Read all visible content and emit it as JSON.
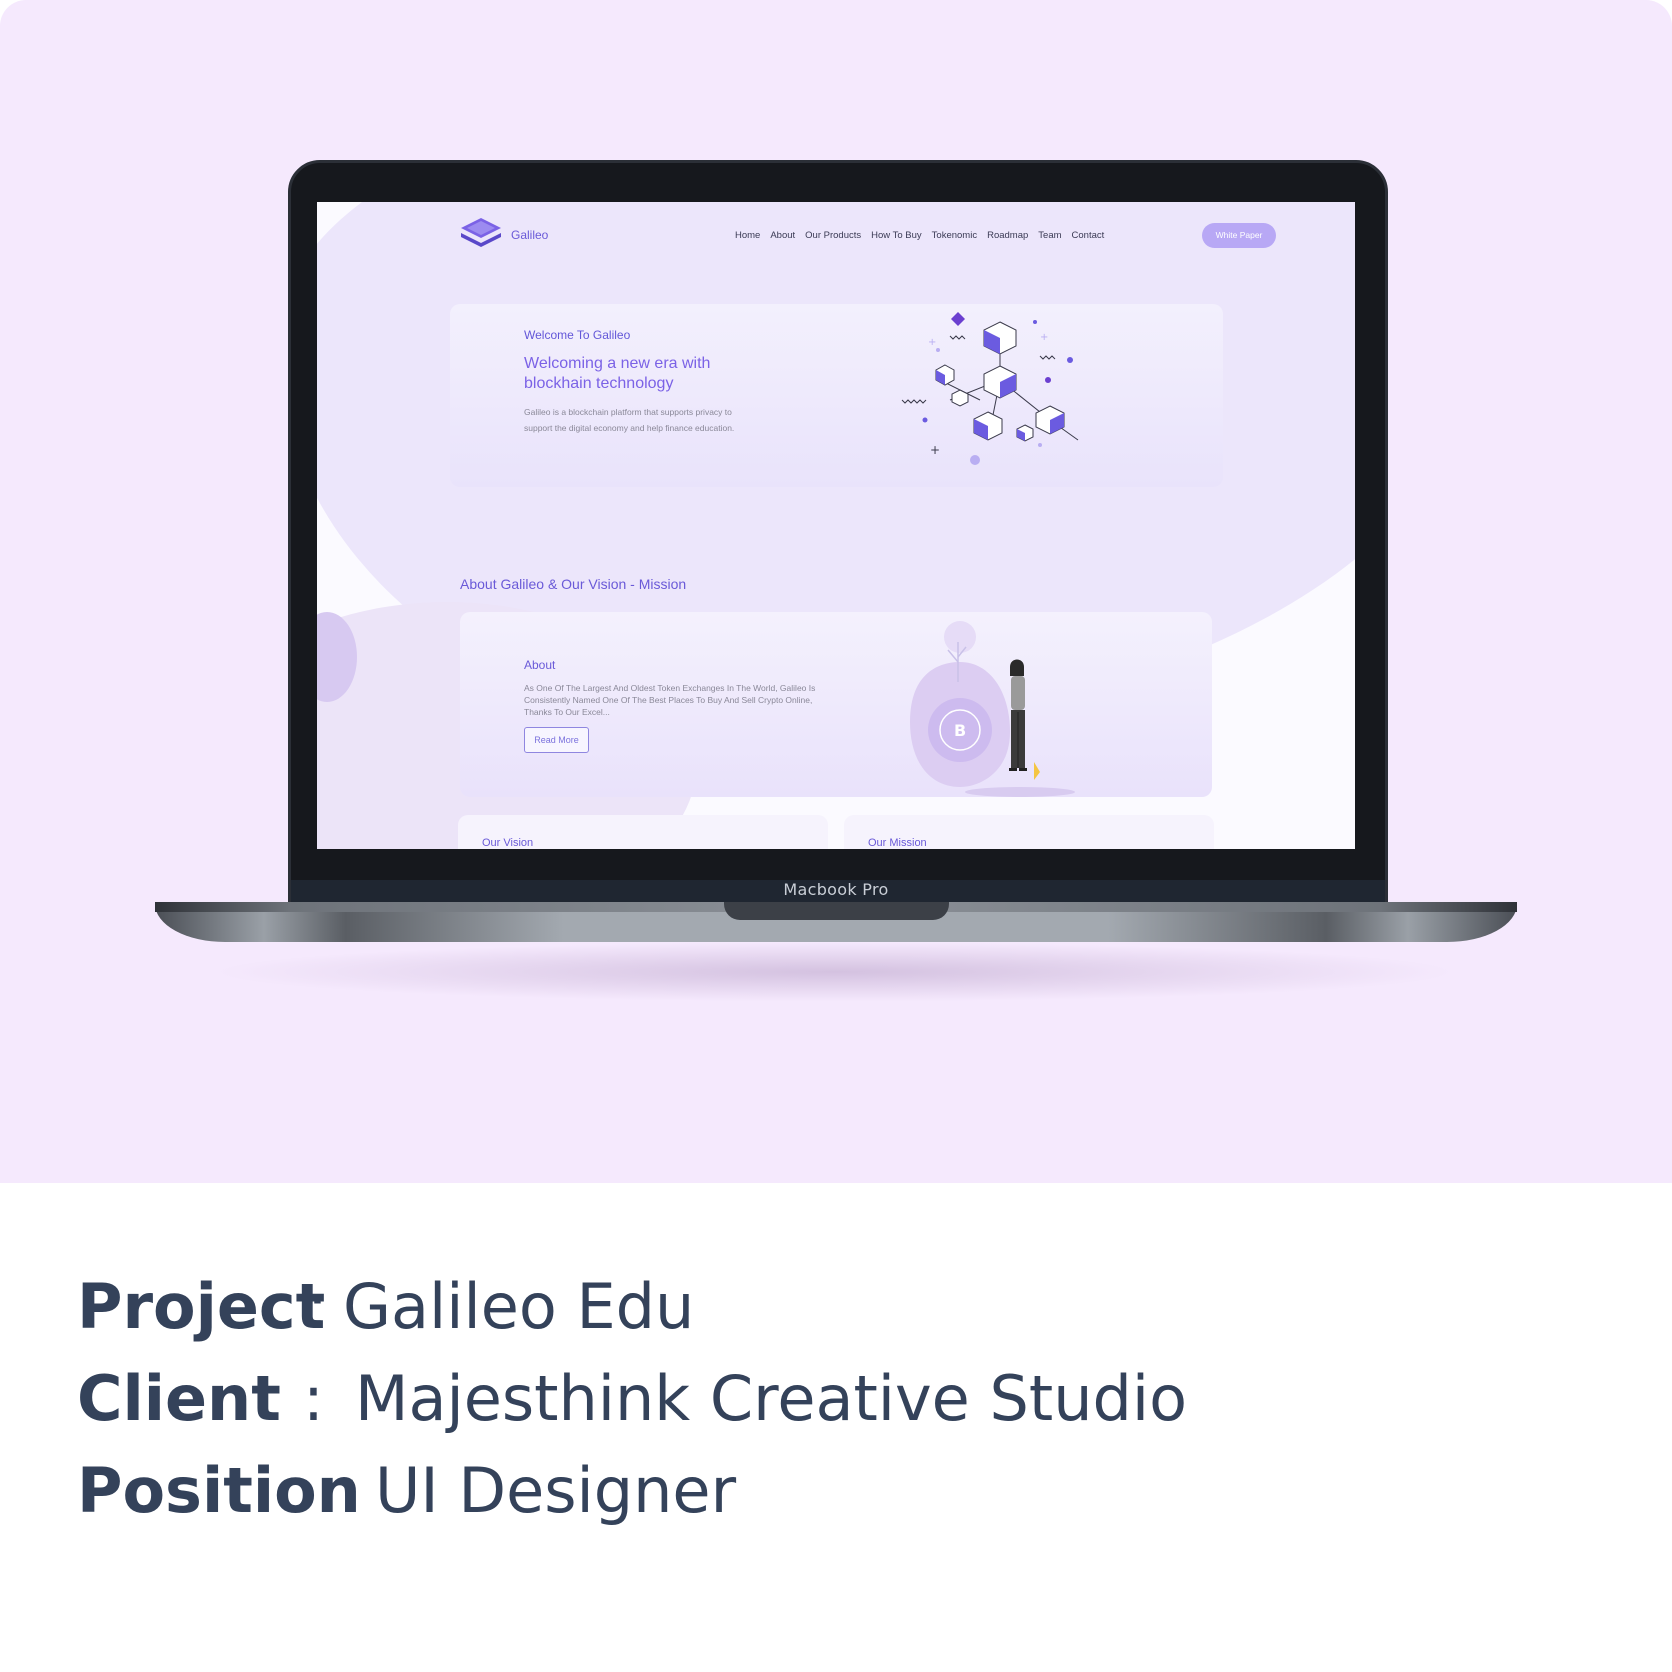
{
  "device": {
    "label": "Macbook Pro"
  },
  "site": {
    "brand": "Galileo",
    "nav": [
      "Home",
      "About",
      "Our Products",
      "How To Buy",
      "Tokenomic",
      "Roadmap",
      "Team",
      "Contact"
    ],
    "nav_button": "White Paper",
    "hero": {
      "kicker": "Welcome To Galileo",
      "title": "Welcoming a new era with blockhain technology",
      "description": "Galileo is a blockchain platform that supports privacy to support the digital economy and help finance education."
    },
    "section_title": "About Galileo & Our Vision - Mission",
    "about": {
      "title": "About",
      "description": "As One Of The Largest And Oldest Token Exchanges In The World, Galileo Is Consistently Named One Of The Best Places To Buy And Sell Crypto Online, Thanks To Our Excel...",
      "button": "Read More"
    },
    "vision_title": "Our Vision",
    "mission_title": "Our Mission"
  },
  "caption": {
    "project_key": "Project",
    "project_sep": ":",
    "project_value": "Galileo Edu",
    "client_key": "Client",
    "client_sep": ":",
    "client_value": "Majesthink Creative Studio",
    "position_key": "Position",
    "position_sep": ":",
    "position_value": "UI Designer"
  },
  "colors": {
    "card_background": "#f5e9fd",
    "accent": "#6a5ad8",
    "caption_text": "#34425a",
    "button": "#b8a8f5"
  }
}
